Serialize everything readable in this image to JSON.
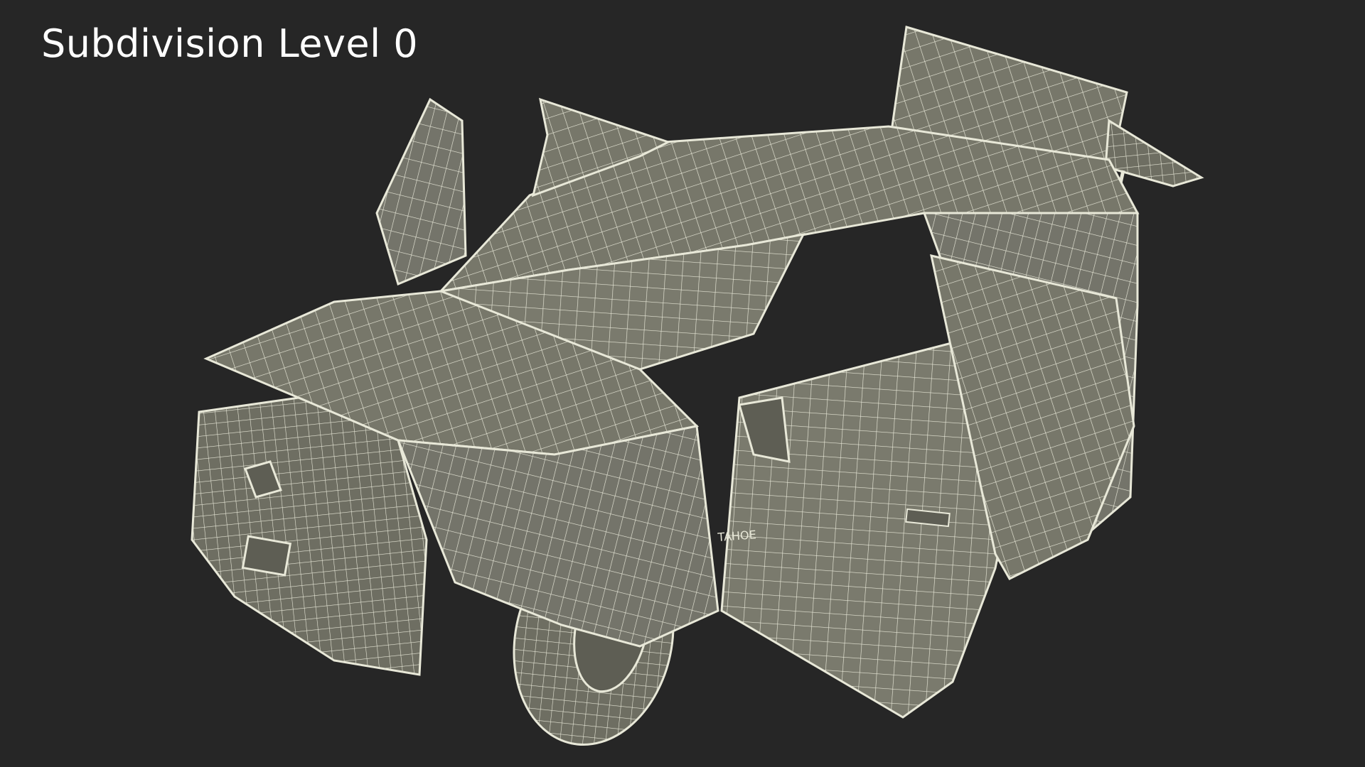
{
  "overlay": {
    "label": "Subdivision Level 0"
  },
  "render": {
    "background_color": "#262626",
    "surface_color": "#77776a",
    "wire_color": "#e8e8d8",
    "badge_text": "TAHOE"
  }
}
